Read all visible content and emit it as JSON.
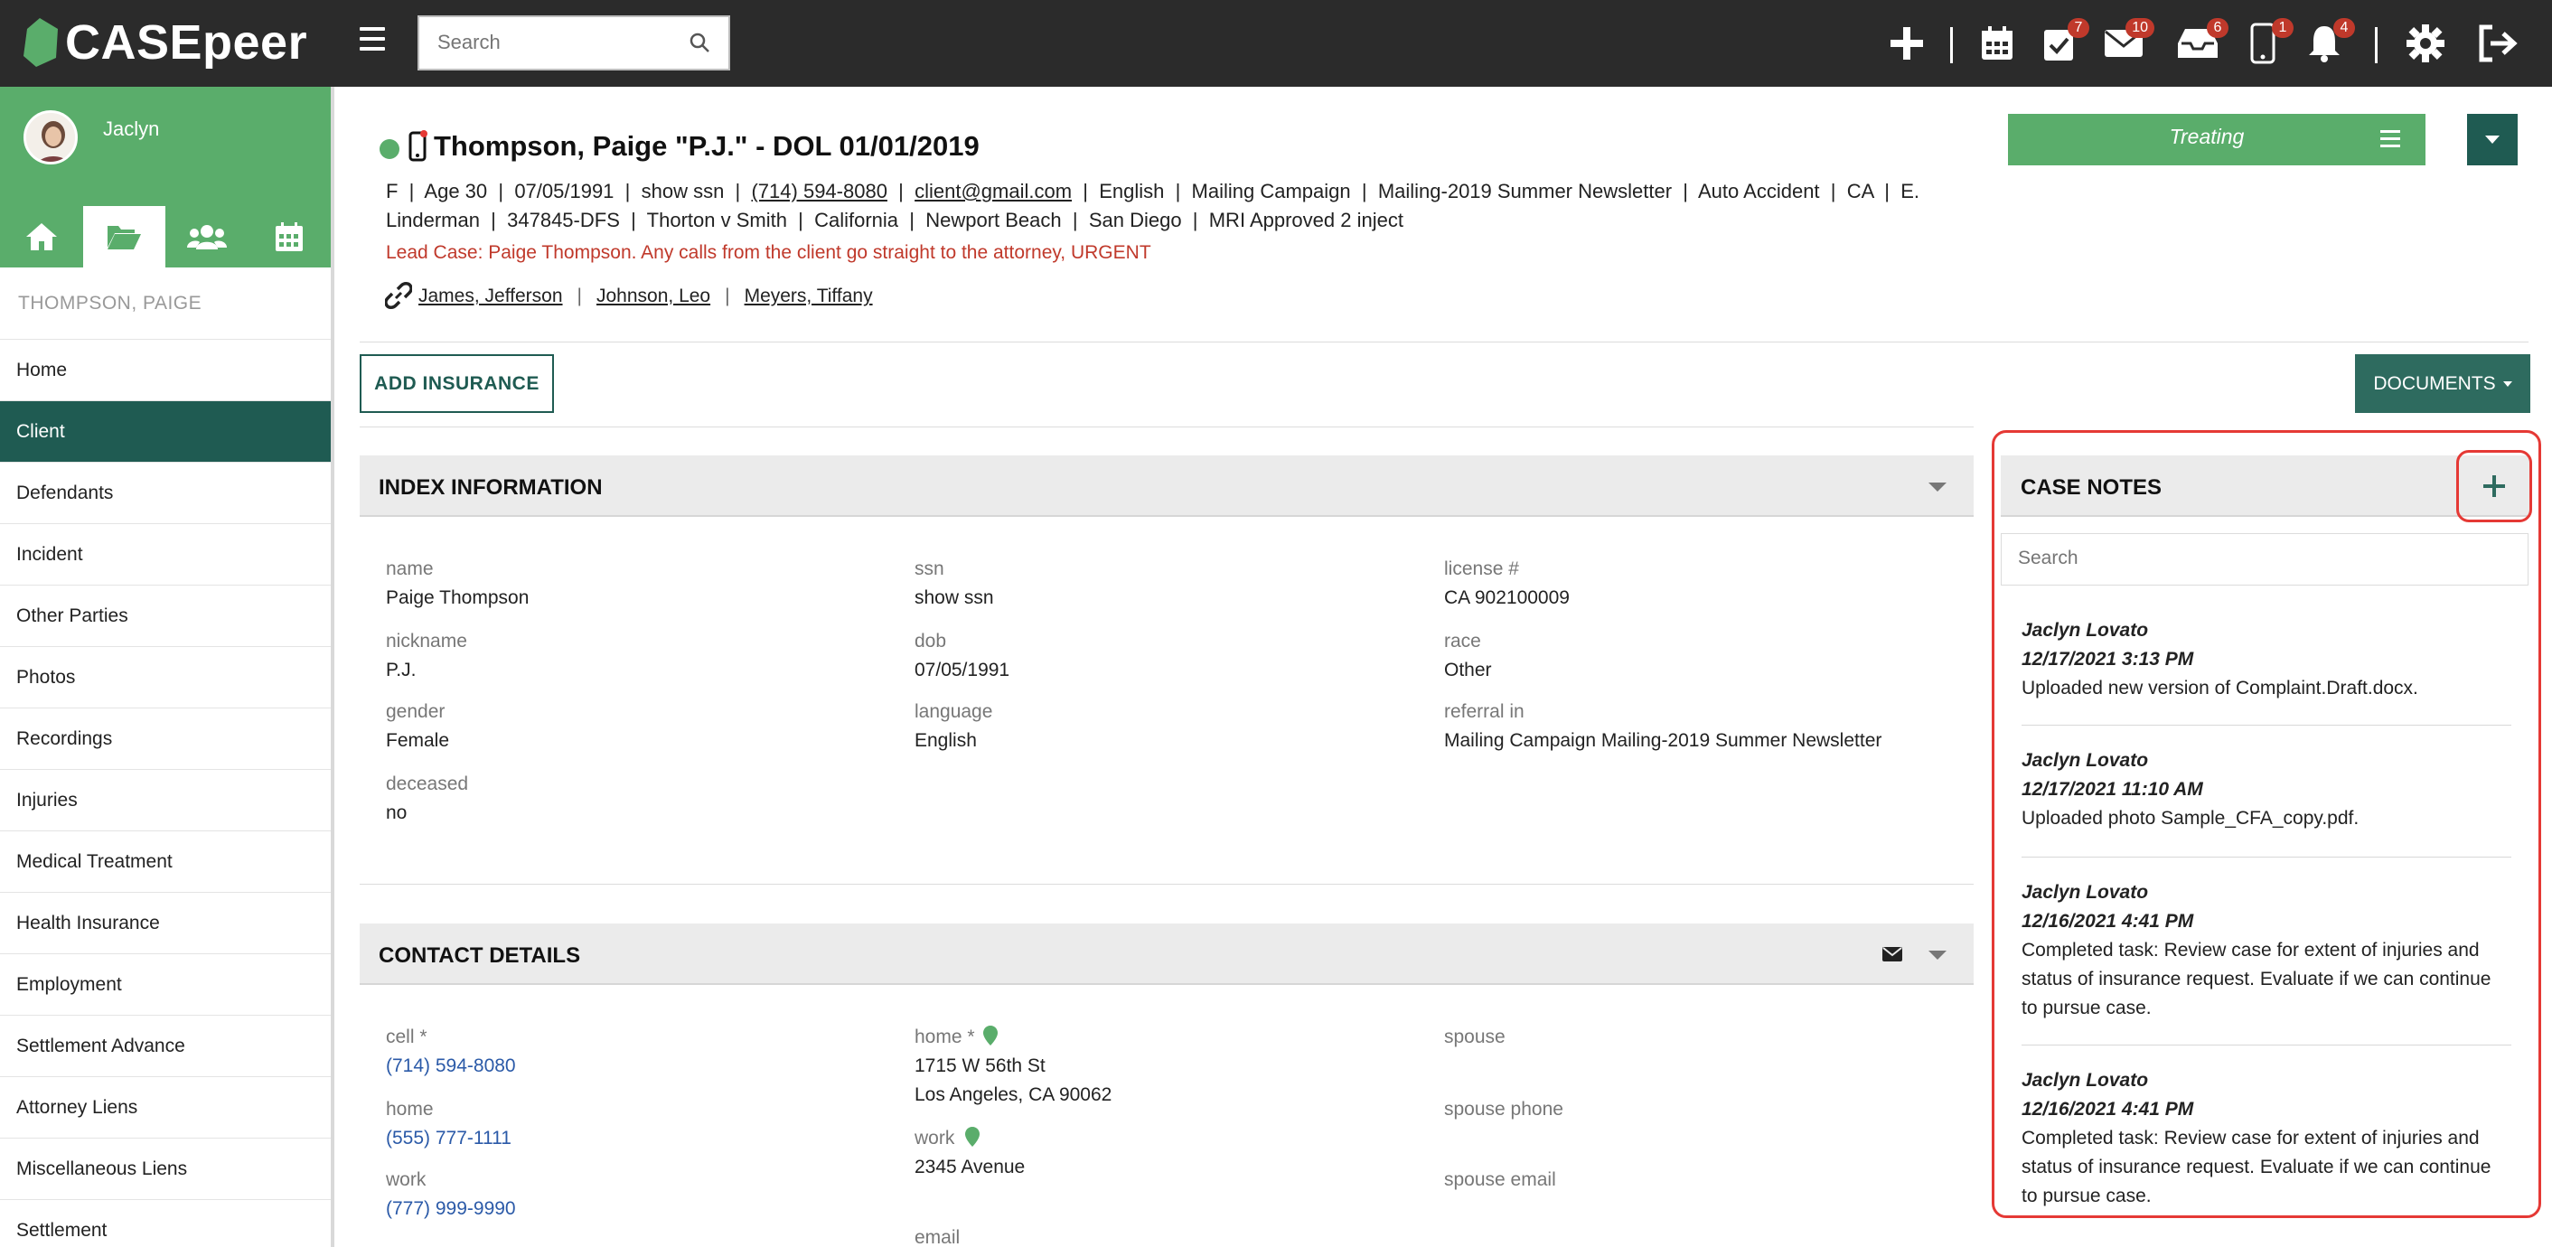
{
  "brand": {
    "name": "CASEpeer"
  },
  "topbar": {
    "search_placeholder": "Search",
    "badges": {
      "tasks": "7",
      "mail": "10",
      "inbox": "6",
      "phone": "1",
      "notifications": "4"
    }
  },
  "sidebar": {
    "user_name": "Jaclyn",
    "case_name": "THOMPSON, PAIGE",
    "items": [
      {
        "label": "Home"
      },
      {
        "label": "Client"
      },
      {
        "label": "Defendants"
      },
      {
        "label": "Incident"
      },
      {
        "label": "Other Parties"
      },
      {
        "label": "Photos"
      },
      {
        "label": "Recordings"
      },
      {
        "label": "Injuries"
      },
      {
        "label": "Medical Treatment"
      },
      {
        "label": "Health Insurance"
      },
      {
        "label": "Employment"
      },
      {
        "label": "Settlement Advance"
      },
      {
        "label": "Attorney Liens"
      },
      {
        "label": "Miscellaneous Liens"
      },
      {
        "label": "Settlement"
      }
    ]
  },
  "case": {
    "title": "Thompson, Paige \"P.J.\" - DOL 01/01/2019",
    "meta": {
      "gender": "F",
      "age": "Age 30",
      "dob": "07/05/1991",
      "ssn": "show ssn",
      "phone": "(714) 594-8080",
      "email": "client@gmail.com",
      "language": "English",
      "source": "Mailing Campaign",
      "campaign": "Mailing-2019 Summer Newsletter",
      "case_type": "Auto Accident",
      "state": "CA",
      "attorney_a": "E.",
      "attorney_b": "Linderman",
      "claim": "347845-DFS",
      "case_caption": "Thorton v Smith",
      "venue": "California",
      "city1": "Newport Beach",
      "city2": "San Diego",
      "note": "MRI Approved 2 inject"
    },
    "lead_note": "Lead Case: Paige Thompson. Any calls from the client go straight to the attorney, URGENT",
    "related": [
      "James, Jefferson",
      "Johnson, Leo",
      "Meyers, Tiffany"
    ],
    "status": "Treating",
    "add_insurance_label": "ADD INSURANCE",
    "documents_label": "DOCUMENTS"
  },
  "index_info": {
    "title": "INDEX INFORMATION",
    "fields": {
      "name": {
        "label": "name",
        "value": "Paige Thompson"
      },
      "ssn": {
        "label": "ssn",
        "value": "show ssn"
      },
      "license": {
        "label": "license #",
        "value": "CA 902100009"
      },
      "nickname": {
        "label": "nickname",
        "value": "P.J."
      },
      "dob": {
        "label": "dob",
        "value": "07/05/1991"
      },
      "race": {
        "label": "race",
        "value": "Other"
      },
      "gender": {
        "label": "gender",
        "value": "Female"
      },
      "language": {
        "label": "language",
        "value": "English"
      },
      "referral": {
        "label": "referral in",
        "value": "Mailing Campaign Mailing-2019 Summer Newsletter"
      },
      "deceased": {
        "label": "deceased",
        "value": "no"
      }
    }
  },
  "contact_details": {
    "title": "CONTACT DETAILS",
    "cell": {
      "label": "cell *",
      "value": "(714) 594-8080"
    },
    "home_phone": {
      "label": "home",
      "value": "(555) 777-1111"
    },
    "work_phone": {
      "label": "work",
      "value": "(777) 999-9990"
    },
    "home_addr": {
      "label": "home *",
      "line1": "1715 W 56th St",
      "line2": "Los Angeles, CA 90062"
    },
    "work_addr": {
      "label": "work",
      "line1": "2345 Avenue"
    },
    "email": {
      "label": "email"
    },
    "spouse": {
      "label": "spouse"
    },
    "spouse_phone": {
      "label": "spouse phone"
    },
    "spouse_email": {
      "label": "spouse email"
    }
  },
  "case_notes": {
    "title": "CASE NOTES",
    "search_placeholder": "Search",
    "notes": [
      {
        "author": "Jaclyn Lovato",
        "date": "12/17/2021 3:13 PM",
        "text": "Uploaded new version of Complaint.Draft.docx."
      },
      {
        "author": "Jaclyn Lovato",
        "date": "12/17/2021 11:10 AM",
        "text": "Uploaded photo Sample_CFA_copy.pdf."
      },
      {
        "author": "Jaclyn Lovato",
        "date": "12/16/2021 4:41 PM",
        "text": "Completed task: Review case for extent of injuries and status of insurance request. Evaluate if we can continue to pursue case."
      },
      {
        "author": "Jaclyn Lovato",
        "date": "12/16/2021 4:41 PM",
        "text": "Completed task: Review case for extent of injuries and status of insurance request. Evaluate if we can continue to pursue case."
      }
    ]
  },
  "colors": {
    "brand_green": "#5aad6b",
    "dark_teal": "#1f5b52",
    "alert_red": "#c0392b",
    "highlight_red": "#e53935"
  }
}
